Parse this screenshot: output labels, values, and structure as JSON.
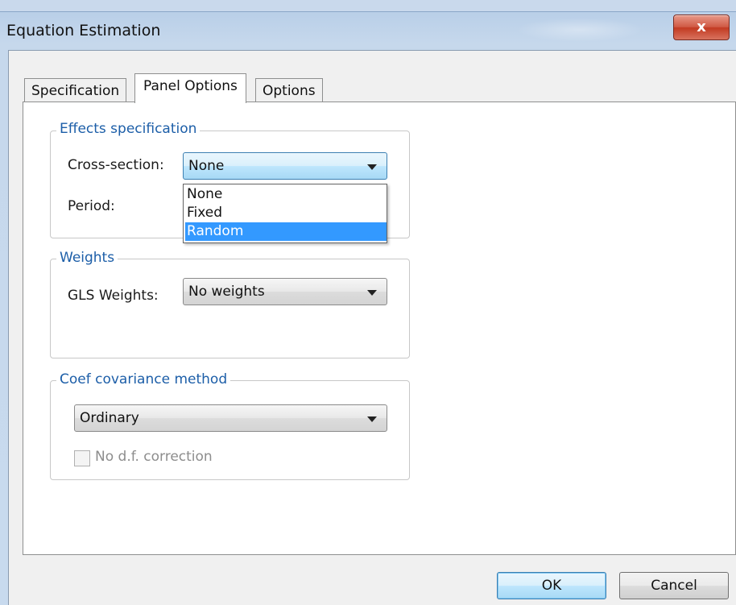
{
  "window": {
    "title": "Equation Estimation",
    "close_label": "x"
  },
  "tabs": [
    {
      "label": "Specification",
      "active": false
    },
    {
      "label": "Panel Options",
      "active": true
    },
    {
      "label": "Options",
      "active": false
    }
  ],
  "effects": {
    "legend": "Effects specification",
    "cross_section_label": "Cross-section:",
    "cross_section_value": "None",
    "period_label": "Period:",
    "dropdown_options": [
      "None",
      "Fixed",
      "Random"
    ],
    "highlighted_option": "Random"
  },
  "weights": {
    "legend": "Weights",
    "gls_label": "GLS Weights:",
    "gls_value": "No weights"
  },
  "coef": {
    "legend": "Coef covariance method",
    "value": "Ordinary",
    "no_df_label": "No d.f. correction",
    "no_df_checked": false,
    "no_df_enabled": false
  },
  "buttons": {
    "ok": "OK",
    "cancel": "Cancel"
  },
  "colors": {
    "legend_text": "#1c5ea8",
    "selection": "#3399ff",
    "close_button": "#c23a22"
  }
}
